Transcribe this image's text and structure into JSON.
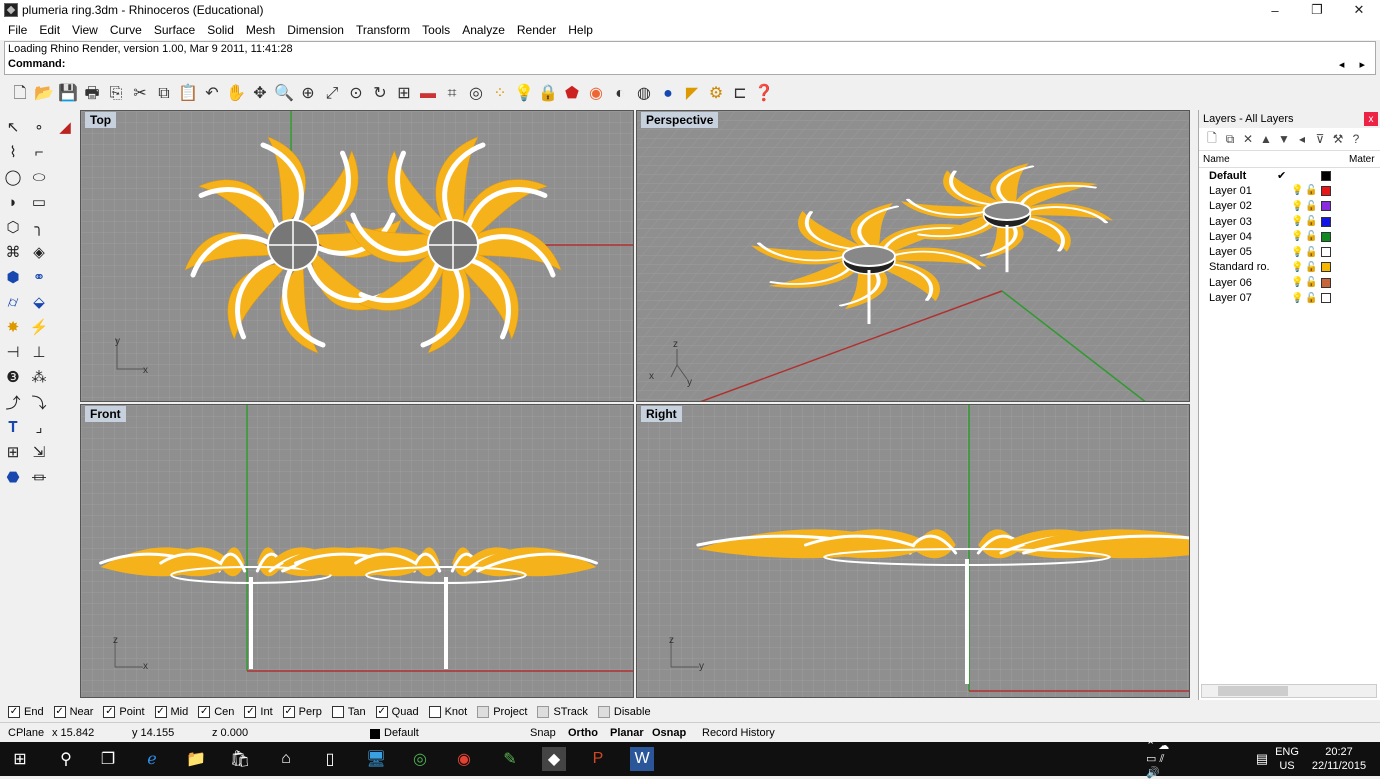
{
  "window": {
    "title": "plumeria ring.3dm - Rhinoceros (Educational)",
    "minimize": "–",
    "maximize": "❐",
    "close": "✕"
  },
  "menu": [
    "File",
    "Edit",
    "View",
    "Curve",
    "Surface",
    "Solid",
    "Mesh",
    "Dimension",
    "Transform",
    "Tools",
    "Analyze",
    "Render",
    "Help"
  ],
  "command": {
    "history": "Loading Rhino Render, version 1.00, Mar  9 2011, 11:41:28",
    "prompt": "Command:",
    "nav": "◂ ▸"
  },
  "viewports": {
    "top": "Top",
    "perspective": "Perspective",
    "front": "Front",
    "right": "Right"
  },
  "axis_labels": {
    "top_y": "y",
    "top_x": "x",
    "persp_z": "z",
    "persp_x": "x",
    "persp_y": "y",
    "front_z": "z",
    "front_x": "x",
    "right_z": "z",
    "right_y": "y"
  },
  "layers": {
    "title": "Layers - All Layers",
    "close": "x",
    "col_name": "Name",
    "col_material": "Mater",
    "items": [
      {
        "name": "Default",
        "current": true,
        "color": "#000000",
        "check": "✔"
      },
      {
        "name": "Layer 01",
        "color": "#e8151b"
      },
      {
        "name": "Layer 02",
        "color": "#8a2be2"
      },
      {
        "name": "Layer 03",
        "color": "#1414e6"
      },
      {
        "name": "Layer 04",
        "color": "#0f8a1f"
      },
      {
        "name": "Layer 05",
        "color": "#ffffff"
      },
      {
        "name": "Standard ro...",
        "color": "#f5b700"
      },
      {
        "name": "Layer 06",
        "color": "#c8643c"
      },
      {
        "name": "Layer 07",
        "color": "#ffffff"
      }
    ]
  },
  "osnaps": [
    {
      "label": "End",
      "checked": true
    },
    {
      "label": "Near",
      "checked": true
    },
    {
      "label": "Point",
      "checked": true
    },
    {
      "label": "Mid",
      "checked": true
    },
    {
      "label": "Cen",
      "checked": true
    },
    {
      "label": "Int",
      "checked": true
    },
    {
      "label": "Perp",
      "checked": true
    },
    {
      "label": "Tan",
      "checked": false
    },
    {
      "label": "Quad",
      "checked": true
    },
    {
      "label": "Knot",
      "checked": false
    },
    {
      "label": "Project",
      "checked": false
    },
    {
      "label": "STrack",
      "checked": false
    },
    {
      "label": "Disable",
      "checked": false
    }
  ],
  "status": {
    "cplane": "CPlane",
    "x": "x 15.842",
    "y": "y 14.155",
    "z": "z 0.000",
    "layer": "Default",
    "snap": "Snap",
    "ortho": "Ortho",
    "planar": "Planar",
    "osnap": "Osnap",
    "record": "Record History"
  },
  "taskbar": {
    "lang": "ENG",
    "region": "US",
    "time": "20:27",
    "date": "22/11/2015"
  },
  "colors": {
    "petal": "#f6b21a",
    "viewport": "#8f8f8f",
    "grid": "#9c9c9c",
    "xaxis": "#b03030",
    "yaxis": "#2f9a2f"
  }
}
